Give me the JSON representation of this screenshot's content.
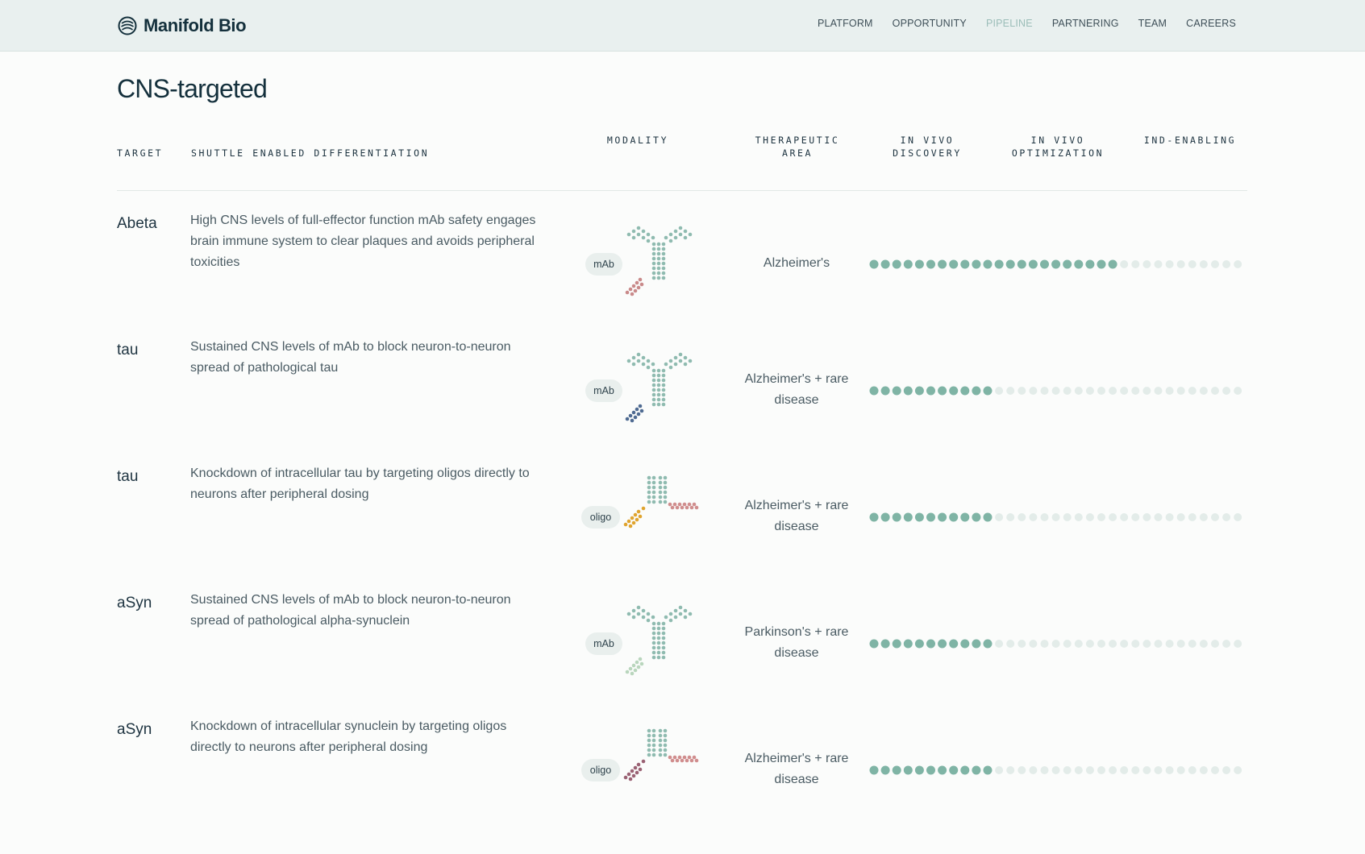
{
  "brand": {
    "name": "Manifold Bio"
  },
  "nav": [
    {
      "label": "PLATFORM",
      "active": false
    },
    {
      "label": "OPPORTUNITY",
      "active": false
    },
    {
      "label": "PIPELINE",
      "active": true
    },
    {
      "label": "PARTNERING",
      "active": false
    },
    {
      "label": "TEAM",
      "active": false
    },
    {
      "label": "CAREERS",
      "active": false
    }
  ],
  "section": {
    "title": "CNS-targeted"
  },
  "columns": {
    "target": "TARGET",
    "differentiation": "SHUTTLE ENABLED DIFFERENTIATION",
    "modality": "MODALITY",
    "area_l1": "THERAPEUTIC",
    "area_l2": "AREA",
    "discovery_l1": "IN VIVO",
    "discovery_l2": "DISCOVERY",
    "optimization_l1": "IN VIVO",
    "optimization_l2": "OPTIMIZATION",
    "ind": "IND-ENABLING"
  },
  "colors": {
    "progress_filled": "#7fb4a5",
    "progress_empty": "#e3ece9",
    "antibody": "#8fbbb0"
  },
  "rows": [
    {
      "target": "Abeta",
      "description": "High CNS levels of full-effector function mAb safety engages brain immune system to clear plaques and avoids peripheral toxicities",
      "modality": "mAb",
      "modality_type": "antibody",
      "shuttle_color": "#c98a8a",
      "area_l1": "Alzheimer's",
      "area_l2": "",
      "progress": {
        "filled": 22,
        "total": 33
      }
    },
    {
      "target": "tau",
      "description": "Sustained CNS levels of mAb to block neuron-to-neuron spread of pathological tau",
      "modality": "mAb",
      "modality_type": "antibody",
      "shuttle_color": "#4f6b92",
      "area_l1": "Alzheimer's + rare",
      "area_l2": "disease",
      "progress": {
        "filled": 11,
        "total": 33
      }
    },
    {
      "target": "tau",
      "description": "Knockdown of intracellular tau by targeting oligos directly to neurons after peripheral dosing",
      "modality": "oligo",
      "modality_type": "oligo",
      "shuttle_color": "#e0a42e",
      "tail_color": "#d08d8d",
      "area_l1": "Alzheimer's + rare",
      "area_l2": "disease",
      "progress": {
        "filled": 11,
        "total": 33
      }
    },
    {
      "target": "aSyn",
      "description": "Sustained CNS levels of mAb to block neuron-to-neuron spread of pathological alpha-synuclein",
      "modality": "mAb",
      "modality_type": "antibody",
      "shuttle_color": "#b9d6bd",
      "area_l1": "Parkinson's + rare",
      "area_l2": "disease",
      "progress": {
        "filled": 11,
        "total": 33
      }
    },
    {
      "target": "aSyn",
      "description": "Knockdown of intracellular synuclein by targeting oligos directly to neurons after peripheral dosing",
      "modality": "oligo",
      "modality_type": "oligo",
      "shuttle_color": "#9a6173",
      "tail_color": "#d08d8d",
      "area_l1": "Alzheimer's + rare",
      "area_l2": "disease",
      "progress": {
        "filled": 11,
        "total": 33
      }
    }
  ]
}
